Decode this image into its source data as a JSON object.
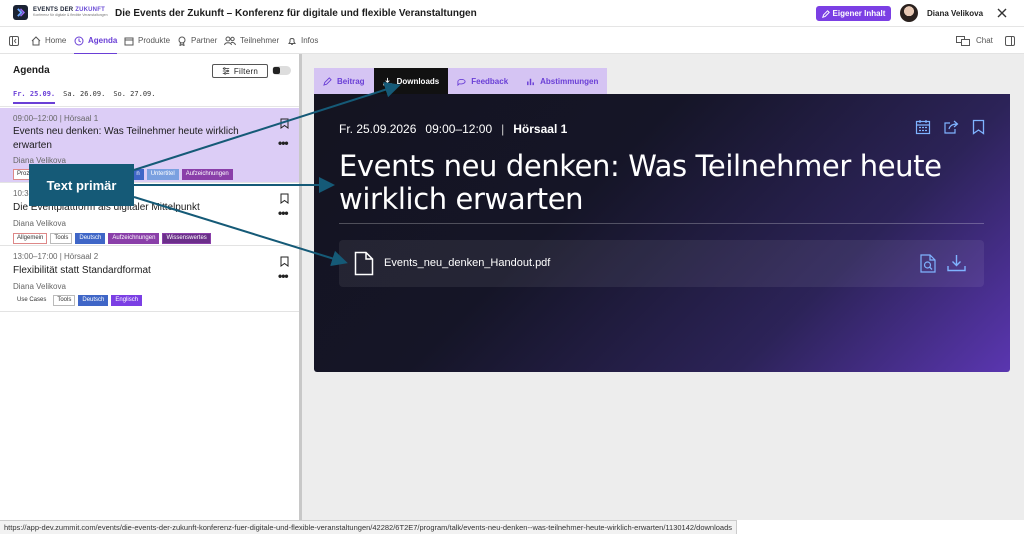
{
  "header": {
    "logo_line1a": "EVENTS DER",
    "logo_line1b": "ZUKUNFT",
    "logo_line2": "Konferenz für digitale & flexible Veranstaltungen",
    "title": "Die Events der Zukunft – Konferenz für digitale und flexible Veranstaltungen",
    "own_content_label": "Eigener Inhalt",
    "user_name": "Diana Velikova",
    "accent_color": "#7b3fe4"
  },
  "nav": {
    "items": [
      {
        "label": "Home",
        "icon": "home-icon"
      },
      {
        "label": "Agenda",
        "icon": "clock-icon"
      },
      {
        "label": "Produkte",
        "icon": "box-icon"
      },
      {
        "label": "Partner",
        "icon": "award-icon"
      },
      {
        "label": "Teilnehmer",
        "icon": "users-icon"
      },
      {
        "label": "Infos",
        "icon": "bell-icon"
      }
    ],
    "active": "Agenda",
    "chat_label": "Chat"
  },
  "agenda": {
    "title": "Agenda",
    "filter_label": "Filtern",
    "days": [
      "Fr. 25.09.",
      "Sa. 26.09.",
      "So. 27.09."
    ],
    "active_day": "Fr. 25.09.",
    "sessions": [
      {
        "meta": "09:00–12:00 | Hörsaal 1",
        "title": "Events neu denken: Was Teilnehmer heute wirklich erwarten",
        "speaker": "Diana Velikova",
        "tags": [
          "Proz",
          "n",
          "Untertitel",
          "Aufzeichnungen"
        ],
        "selected": true
      },
      {
        "meta": "10:3",
        "title": "Die Eventplattform als digitaler Mittelpunkt",
        "speaker": "Diana Velikova",
        "tags": [
          "Allgemein",
          "Tools",
          "Deutsch",
          "Aufzeichnungen",
          "Wissenswertes"
        ],
        "selected": false
      },
      {
        "meta": "13:00–17:00 | Hörsaal 2",
        "title": "Flexibilität statt Standardformat",
        "speaker": "Diana Velikova",
        "tags": [
          "Use Cases",
          "Tools",
          "Deutsch",
          "Englisch"
        ],
        "selected": false
      }
    ]
  },
  "callout": {
    "label": "Text primär",
    "color": "#155a77"
  },
  "content": {
    "tabs": [
      {
        "label": "Beitrag",
        "icon": "edit-icon"
      },
      {
        "label": "Downloads",
        "icon": "download-icon"
      },
      {
        "label": "Feedback",
        "icon": "chat-bubble-icon"
      },
      {
        "label": "Abstimmungen",
        "icon": "bar-chart-icon"
      }
    ],
    "active_tab": "Downloads",
    "date": "Fr. 25.09.2026",
    "time": "09:00–12:00",
    "separator": "|",
    "room": "Hörsaal 1",
    "title": "Events neu denken: Was Teilnehmer heute wirklich erwarten",
    "file_name": "Events_neu_denken_Handout.pdf"
  },
  "status_url": "https://app-dev.zummit.com/events/die-events-der-zukunft-konferenz-fuer-digitale-und-flexible-veranstaltungen/42282/6T2E7/program/talk/events-neu-denken--was-teilnehmer-heute-wirklich-erwarten/1130142/downloads"
}
